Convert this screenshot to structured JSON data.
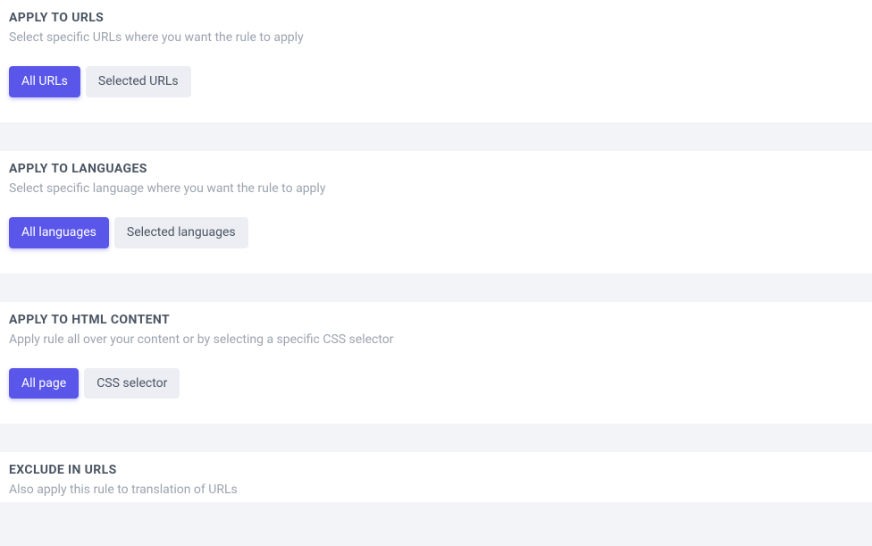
{
  "sections": {
    "urls": {
      "title": "APPLY TO URLS",
      "subtitle": "Select specific URLs where you want the rule to apply",
      "option_active": "All URLs",
      "option_inactive": "Selected URLs"
    },
    "languages": {
      "title": "APPLY TO LANGUAGES",
      "subtitle": "Select specific language where you want the rule to apply",
      "option_active": "All languages",
      "option_inactive": "Selected languages"
    },
    "html": {
      "title": "APPLY TO HTML CONTENT",
      "subtitle": "Apply rule all over your content or by selecting a specific CSS selector",
      "option_active": "All page",
      "option_inactive": "CSS selector"
    },
    "exclude": {
      "title": "EXCLUDE IN URLS",
      "subtitle": "Also apply this rule to translation of URLs"
    }
  }
}
